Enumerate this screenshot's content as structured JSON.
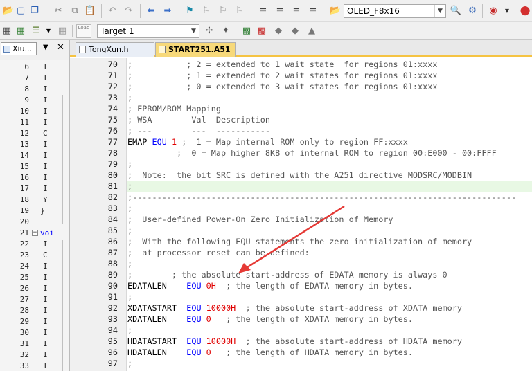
{
  "toolbar1": {
    "target_file_combo": "OLED_F8x16",
    "icons": [
      "open-folder-icon",
      "save-icon",
      "save-all-icon",
      "cut-icon",
      "copy-icon",
      "paste-icon",
      "undo-icon",
      "redo-icon",
      "nav-back-icon",
      "nav-forward-icon",
      "bookmark-icon",
      "prev-bookmark-icon",
      "next-bookmark-icon",
      "clear-bookmarks-icon",
      "indent-icon",
      "unindent-icon",
      "comment-icon",
      "uncomment-icon",
      "find-in-files-icon",
      "find-icon",
      "search-icon",
      "debug-start-icon"
    ]
  },
  "toolbar2": {
    "load_label": "Load",
    "target_combo": "Target 1",
    "icons": [
      "translate-icon",
      "build-icon",
      "rebuild-icon",
      "batch-build-icon",
      "stop-build-icon",
      "download-icon",
      "target-options-icon",
      "manage-components-icon",
      "select-packs-icon",
      "pack-installer-icon",
      "pack-icon"
    ]
  },
  "left_pane": {
    "tab_label": "Xiu...",
    "menu_glyph": "▼",
    "close_glyph": "✕",
    "rows": [
      {
        "n": "6",
        "t": "I"
      },
      {
        "n": "7",
        "t": "I"
      },
      {
        "n": "8",
        "t": "I"
      },
      {
        "n": "9",
        "t": "I"
      },
      {
        "n": "10",
        "t": "I"
      },
      {
        "n": "11",
        "t": "I"
      },
      {
        "n": "12",
        "t": "C"
      },
      {
        "n": "13",
        "t": "I"
      },
      {
        "n": "14",
        "t": "I"
      },
      {
        "n": "15",
        "t": "I"
      },
      {
        "n": "16",
        "t": "I"
      },
      {
        "n": "17",
        "t": "I"
      },
      {
        "n": "18",
        "t": "Y"
      },
      {
        "n": "19",
        "t": "}"
      },
      {
        "n": "20",
        "t": ""
      },
      {
        "n": "21",
        "t": "voi"
      },
      {
        "n": "22",
        "t": "I"
      },
      {
        "n": "23",
        "t": "C"
      },
      {
        "n": "24",
        "t": "I"
      },
      {
        "n": "25",
        "t": "I"
      },
      {
        "n": "26",
        "t": "I"
      },
      {
        "n": "27",
        "t": "I"
      },
      {
        "n": "28",
        "t": "I"
      },
      {
        "n": "29",
        "t": "I"
      },
      {
        "n": "30",
        "t": "I"
      },
      {
        "n": "31",
        "t": "I"
      },
      {
        "n": "32",
        "t": "I"
      },
      {
        "n": "33",
        "t": "I"
      }
    ]
  },
  "editor": {
    "tabs": [
      {
        "label": "TongXun.h",
        "active": false
      },
      {
        "label": "START251.A51",
        "active": true
      }
    ],
    "lines": [
      {
        "n": "70",
        "s": [
          {
            "c": "cm",
            "t": ";           ; 2 = extended to 1 wait state  for regions 01:xxxx"
          }
        ]
      },
      {
        "n": "71",
        "s": [
          {
            "c": "cm",
            "t": ";           ; 1 = extended to 2 wait states for regions 01:xxxx"
          }
        ]
      },
      {
        "n": "72",
        "s": [
          {
            "c": "cm",
            "t": ";           ; 0 = extended to 3 wait states for regions 01:xxxx"
          }
        ]
      },
      {
        "n": "73",
        "s": [
          {
            "c": "cm",
            "t": ";"
          }
        ]
      },
      {
        "n": "74",
        "s": [
          {
            "c": "cm",
            "t": "; EPROM/ROM Mapping"
          }
        ]
      },
      {
        "n": "75",
        "s": [
          {
            "c": "cm",
            "t": "; WSA        Val  Description"
          }
        ]
      },
      {
        "n": "76",
        "s": [
          {
            "c": "cm",
            "t": "; ---        ---  -----------"
          }
        ]
      },
      {
        "n": "77",
        "s": [
          {
            "c": "id",
            "t": "EMAP "
          },
          {
            "c": "k",
            "t": "EQU"
          },
          {
            "c": "id",
            "t": " "
          },
          {
            "c": "n",
            "t": "1"
          },
          {
            "c": "cm",
            "t": " ;  1 = Map internal ROM only to region FF:xxxx"
          }
        ]
      },
      {
        "n": "78",
        "s": [
          {
            "c": "cm",
            "t": "          ;  0 = Map higher 8KB of internal ROM to region 00:E000 - 00:FFFF"
          }
        ]
      },
      {
        "n": "79",
        "s": [
          {
            "c": "cm",
            "t": ";"
          }
        ]
      },
      {
        "n": "80",
        "s": [
          {
            "c": "cm",
            "t": ";  Note:  the bit SRC is defined with the A251 directive MODSRC/MODBIN"
          }
        ]
      },
      {
        "n": "81",
        "hl": true,
        "caret": true,
        "s": [
          {
            "c": "cm",
            "t": ";"
          }
        ]
      },
      {
        "n": "82",
        "s": [
          {
            "c": "cm",
            "t": ";------------------------------------------------------------------------------"
          }
        ]
      },
      {
        "n": "83",
        "s": [
          {
            "c": "cm",
            "t": ";"
          }
        ]
      },
      {
        "n": "84",
        "s": [
          {
            "c": "cm",
            "t": ";  User-defined Power-On Zero Initialization of Memory"
          }
        ]
      },
      {
        "n": "85",
        "s": [
          {
            "c": "cm",
            "t": ";"
          }
        ]
      },
      {
        "n": "86",
        "s": [
          {
            "c": "cm",
            "t": ";  With the following EQU statements the zero initialization of memory"
          }
        ]
      },
      {
        "n": "87",
        "s": [
          {
            "c": "cm",
            "t": ";  at processor reset can be defined:"
          }
        ]
      },
      {
        "n": "88",
        "s": [
          {
            "c": "cm",
            "t": ";"
          }
        ]
      },
      {
        "n": "89",
        "s": [
          {
            "c": "cm",
            "t": ";        ; the absolute start-address of EDATA memory is always 0"
          }
        ]
      },
      {
        "n": "90",
        "s": [
          {
            "c": "id",
            "t": "EDATALEN    "
          },
          {
            "c": "k",
            "t": "EQU"
          },
          {
            "c": "id",
            "t": " "
          },
          {
            "c": "n",
            "t": "0H"
          },
          {
            "c": "cm",
            "t": "  ; the length of EDATA memory in bytes."
          }
        ]
      },
      {
        "n": "91",
        "s": [
          {
            "c": "cm",
            "t": ";"
          }
        ]
      },
      {
        "n": "92",
        "s": [
          {
            "c": "id",
            "t": "XDATASTART  "
          },
          {
            "c": "k",
            "t": "EQU"
          },
          {
            "c": "id",
            "t": " "
          },
          {
            "c": "n",
            "t": "10000H"
          },
          {
            "c": "cm",
            "t": "  ; the absolute start-address of XDATA memory"
          }
        ]
      },
      {
        "n": "93",
        "s": [
          {
            "c": "id",
            "t": "XDATALEN    "
          },
          {
            "c": "k",
            "t": "EQU"
          },
          {
            "c": "id",
            "t": " "
          },
          {
            "c": "n",
            "t": "0"
          },
          {
            "c": "cm",
            "t": "   ; the length of XDATA memory in bytes."
          }
        ]
      },
      {
        "n": "94",
        "s": [
          {
            "c": "cm",
            "t": ";"
          }
        ]
      },
      {
        "n": "95",
        "s": [
          {
            "c": "id",
            "t": "HDATASTART  "
          },
          {
            "c": "k",
            "t": "EQU"
          },
          {
            "c": "id",
            "t": " "
          },
          {
            "c": "n",
            "t": "10000H"
          },
          {
            "c": "cm",
            "t": "  ; the absolute start-address of HDATA memory"
          }
        ]
      },
      {
        "n": "96",
        "s": [
          {
            "c": "id",
            "t": "HDATALEN    "
          },
          {
            "c": "k",
            "t": "EQU"
          },
          {
            "c": "id",
            "t": " "
          },
          {
            "c": "n",
            "t": "0"
          },
          {
            "c": "cm",
            "t": "   ; the length of HDATA memory in bytes."
          }
        ]
      },
      {
        "n": "97",
        "s": [
          {
            "c": "cm",
            "t": ";"
          }
        ]
      }
    ]
  },
  "annotation": {
    "arrow_color": "#e53935",
    "arrow_target": "line-90 EQU 0H"
  },
  "colors": {
    "keyword": "#0000ff",
    "number": "#e00000",
    "comment": "#555555",
    "active_tab": "#f7d97a",
    "current_line": "#e8f8e4"
  }
}
